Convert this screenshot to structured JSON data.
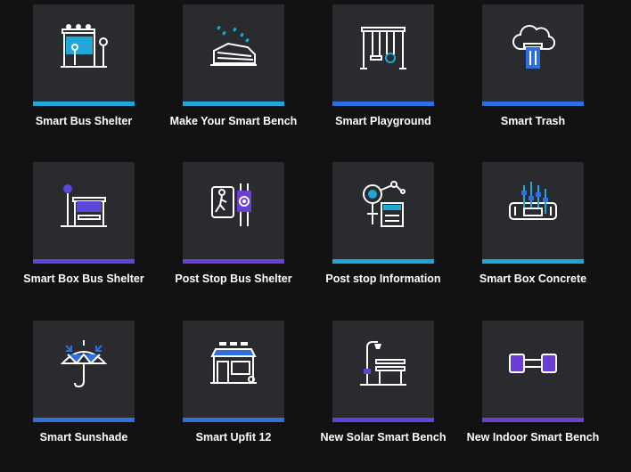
{
  "colors": {
    "background": "#121213",
    "tile": "#2a2b2e",
    "accent_blue": "#2f7de3",
    "accent_cyan": "#1ea7d8",
    "accent_violet": "#6b3fd6"
  },
  "products": [
    {
      "label": "Smart Bus Shelter",
      "icon": "bus-shelter-icon",
      "bar_color": "#1ea7d8"
    },
    {
      "label": "Make Your Smart Bench",
      "icon": "bench-icon",
      "bar_color": "#1ea7d8"
    },
    {
      "label": "Smart Playground",
      "icon": "playground-swing-icon",
      "bar_color": "#2f6fe0"
    },
    {
      "label": "Smart Trash",
      "icon": "cloud-trash-icon",
      "bar_color": "#2f6fe0"
    },
    {
      "label": "Smart Box Bus Shelter",
      "icon": "box-bus-shelter-icon",
      "bar_color": "#5a46d8"
    },
    {
      "label": "Post Stop Bus Shelter",
      "icon": "pedestrian-signal-icon",
      "bar_color": "#6b3fd6"
    },
    {
      "label": "Post stop Information",
      "icon": "info-kiosk-icon",
      "bar_color": "#1ea7d8"
    },
    {
      "label": "Smart Box Concrete",
      "icon": "concrete-box-icon",
      "bar_color": "#1ea7d8"
    },
    {
      "label": "Smart Sunshade",
      "icon": "umbrella-icon",
      "bar_color": "#2f6fe0"
    },
    {
      "label": "Smart Upfit 12",
      "icon": "upfit-storefront-icon",
      "bar_color": "#2f6fe0"
    },
    {
      "label": "New Solar Smart Bench",
      "icon": "solar-bench-icon",
      "bar_color": "#5a46d8"
    },
    {
      "label": "New Indoor Smart Bench",
      "icon": "indoor-bench-icon",
      "bar_color": "#6b3fd6"
    }
  ]
}
